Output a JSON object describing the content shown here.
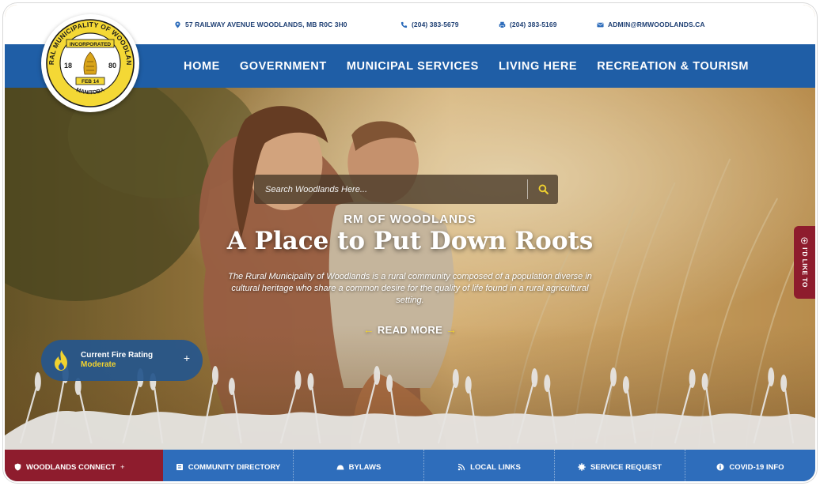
{
  "topbar": {
    "address": "57 RAILWAY AVENUE WOODLANDS, MB R0C 3H0",
    "phone": "(204) 383-5679",
    "fax": "(204) 383-5169",
    "email": "ADMIN@RMWOODLANDS.CA"
  },
  "logo": {
    "ring_text": "RURAL MUNICIPALITY OF WOODLANDS",
    "incorporated": "INCORPORATED",
    "year_left": "18",
    "year_right": "80",
    "date": "FEB 14",
    "province": "MANITOBA"
  },
  "nav": {
    "items": [
      "HOME",
      "GOVERNMENT",
      "MUNICIPAL SERVICES",
      "LIVING HERE",
      "RECREATION & TOURISM"
    ]
  },
  "hero": {
    "search_placeholder": "Search Woodlands Here...",
    "eyebrow": "RM OF WOODLANDS",
    "headline": "A Place to Put Down Roots",
    "tagline": "The Rural Municipality of Woodlands is a rural community composed of a population diverse in cultural heritage who share a common desire for the quality of life found in a rural agricultural setting.",
    "read_more": "READ MORE"
  },
  "fire": {
    "title": "Current Fire Rating",
    "value": "Moderate",
    "plus": "+"
  },
  "side_tab": {
    "label": "I'D LIKE TO"
  },
  "bottom": {
    "connect": "WOODLANDS CONNECT",
    "connect_plus": "+",
    "links": [
      "COMMUNITY DIRECTORY",
      "BYLAWS",
      "LOCAL LINKS",
      "SERVICE REQUEST",
      "COVID-19 INFO"
    ]
  },
  "colors": {
    "primary_blue": "#1f5ea6",
    "bottom_blue": "#2e6dbb",
    "maroon": "#8e1c2d",
    "accent_yellow": "#f1d22f",
    "topbar_text": "#1e3f73"
  },
  "icons": {
    "address": "map-pin-icon",
    "phone": "phone-icon",
    "fax": "fax-icon",
    "email": "envelope-icon",
    "search": "search-icon",
    "fire": "flame-icon",
    "side_tab": "plus-circle-icon",
    "connect": "shield-icon",
    "directory": "book-icon",
    "bylaws": "gavel-icon",
    "links": "rss-icon",
    "service": "gear-icon",
    "covid": "info-icon"
  }
}
